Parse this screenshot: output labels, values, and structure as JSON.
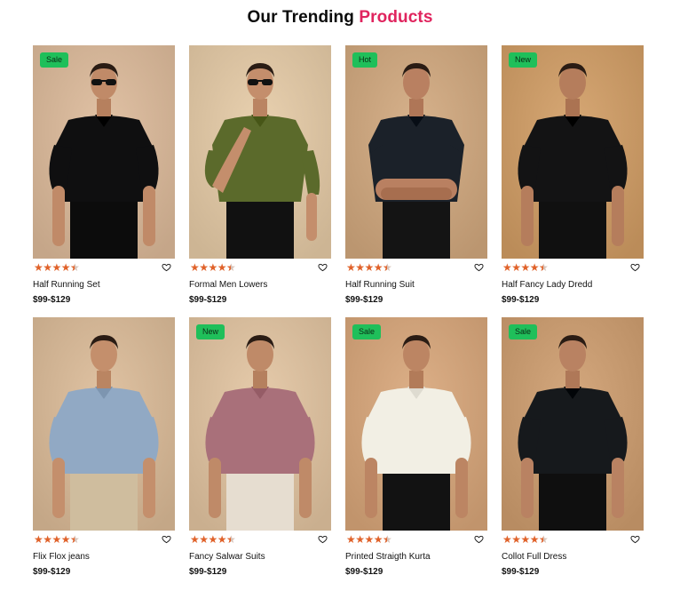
{
  "section_title": {
    "main": "Our Trending ",
    "accent": "Products"
  },
  "products": [
    {
      "badge": "Sale",
      "rating": 4.5,
      "name": "Half Running Set",
      "price": "$99-$129",
      "bg": "#d3b497",
      "shirt": "#0f0f10",
      "pants": "#0c0c0c",
      "skin": "#c08a68",
      "glasses": true,
      "pose": "hands"
    },
    {
      "badge": "",
      "rating": 4.5,
      "name": "Formal Men Lowers",
      "price": "$99-$129",
      "bg": "#dbc3a2",
      "shirt": "#5b6a2b",
      "pants": "#111111",
      "skin": "#c48e6c",
      "glasses": true,
      "pose": "chin"
    },
    {
      "badge": "Hot",
      "rating": 4.5,
      "name": "Half Running Suit",
      "price": "$99-$129",
      "bg": "#c9a47e",
      "shirt": "#1b2129",
      "pants": "#141414",
      "skin": "#b98061",
      "glasses": false,
      "pose": "crossed"
    },
    {
      "badge": "New",
      "rating": 4.5,
      "name": "Half Fancy Lady Dredd",
      "price": "$99-$129",
      "bg": "#c99a67",
      "shirt": "#131314",
      "pants": "#101010",
      "skin": "#b57d5c",
      "glasses": false,
      "pose": "hands"
    },
    {
      "badge": "",
      "rating": 4.5,
      "name": "Flix Flox jeans",
      "price": "$99-$129",
      "bg": "#d2b595",
      "shirt": "#91a9c4",
      "pants": "#cfbd9e",
      "skin": "#c48f6c",
      "glasses": false,
      "pose": "hands"
    },
    {
      "badge": "New",
      "rating": 4.5,
      "name": "Fancy Salwar Suits",
      "price": "$99-$129",
      "bg": "#d8bd9d",
      "shirt": "#a9707a",
      "pants": "#e6ddd0",
      "skin": "#bf8a68",
      "glasses": false,
      "pose": "hands"
    },
    {
      "badge": "Sale",
      "rating": 4.5,
      "name": "Printed Straigth Kurta",
      "price": "$99-$129",
      "bg": "#cfa27a",
      "shirt": "#f2efe4",
      "pants": "#121212",
      "skin": "#bc8563",
      "glasses": false,
      "pose": "hands"
    },
    {
      "badge": "Sale",
      "rating": 4.5,
      "name": "Collot Full Dress",
      "price": "$99-$129",
      "bg": "#c69a70",
      "shirt": "#16191c",
      "pants": "#0f0f0f",
      "skin": "#b98262",
      "glasses": false,
      "pose": "hands"
    }
  ],
  "colors": {
    "badge": "#1fbf5a",
    "accent": "#e0245e",
    "star": "#e0622a"
  },
  "icons": {
    "rating": "star-icon",
    "wishlist": "heart-outline-icon"
  }
}
